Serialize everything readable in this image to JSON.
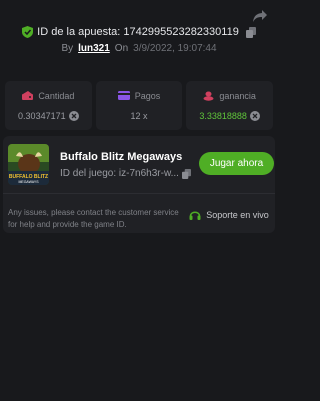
{
  "header": {
    "bet_id_label": "ID de la apuesta: 174299552328233011​9",
    "by_label": "By",
    "username": "lun321",
    "on_label": "On",
    "datetime": "3/9/2022, 19:07:44"
  },
  "stats": [
    {
      "label": "Cantidad",
      "value": "0.30347171"
    },
    {
      "label": "Pagos",
      "value": "12 x"
    },
    {
      "label": "ganancia",
      "value": "3.33818888"
    }
  ],
  "game": {
    "title": "Buffalo Blitz Megaways",
    "id_text": "ID del juego: iz-7n6h3r-w...",
    "play_label": "Jugar ahora",
    "thumb_text": "BUFFALO BLITZ MEGAWAYS"
  },
  "help": {
    "text": "Any issues, please contact the customer service for help and provide the game ID.",
    "support_label": "Soporte en vivo"
  },
  "colors": {
    "accent_green": "#4fae25",
    "win_green": "#5fc43a",
    "background": "#18191c",
    "card": "#202125"
  },
  "icons": [
    "share-icon",
    "shield-check-icon",
    "copy-icon",
    "wallet-icon",
    "card-icon",
    "coins-icon",
    "coin-icon",
    "headset-icon"
  ]
}
